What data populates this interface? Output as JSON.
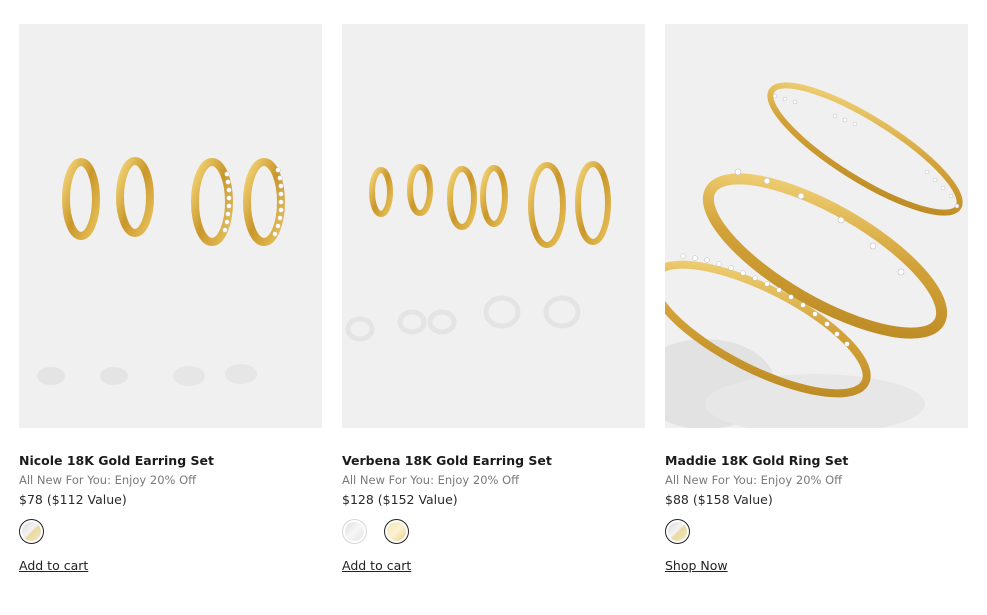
{
  "products": [
    {
      "name": "Nicole 18K Gold Earring Set",
      "promo": "All New For You: Enjoy 20% Off",
      "price": "$78 ($112 Value)",
      "cta": "Add to cart",
      "swatches": [
        "mixed"
      ]
    },
    {
      "name": "Verbena 18K Gold Earring Set",
      "promo": "All New For You: Enjoy 20% Off",
      "price": "$128 ($152 Value)",
      "cta": "Add to cart",
      "swatches": [
        "silver",
        "gold"
      ],
      "selected_swatch": "gold"
    },
    {
      "name": "Maddie 18K Gold Ring Set",
      "promo": "All New For You: Enjoy 20% Off",
      "price": "$88 ($158 Value)",
      "cta": "Shop Now",
      "swatches": [
        "mixed"
      ]
    }
  ],
  "colors": {
    "image_background": "#f0f0f0",
    "gold": "#d4a93a",
    "text": "#1b1b1b",
    "muted_text": "#7a7a7a"
  }
}
